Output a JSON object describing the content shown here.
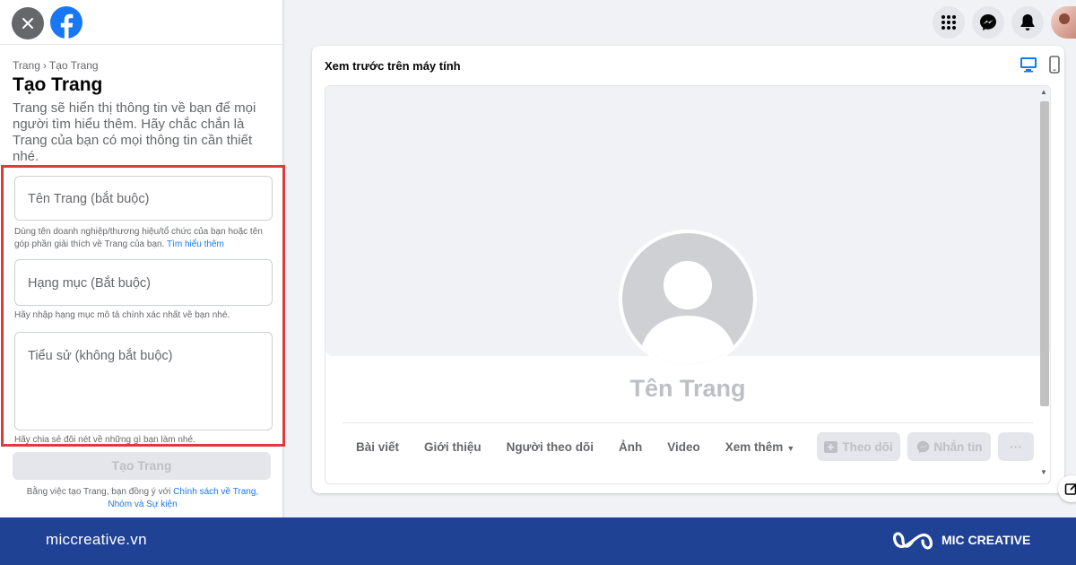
{
  "left_panel": {
    "breadcrumb": {
      "parent": "Trang",
      "separator": "›",
      "current": "Tạo Trang"
    },
    "title": "Tạo Trang",
    "description": "Trang sẽ hiển thị thông tin về bạn để mọi người tìm hiểu thêm. Hãy chắc chắn là Trang của bạn có mọi thông tin cần thiết nhé.",
    "form": {
      "page_name_placeholder": "Tên Trang (bắt buộc)",
      "page_name_hint": "Dùng tên doanh nghiệp/thương hiệu/tổ chức của bạn hoặc tên góp phần giải thích về Trang của bạn.",
      "page_name_hint_link": "Tìm hiểu thêm",
      "category_placeholder": "Hạng mục (Bắt buộc)",
      "category_hint": "Hãy nhập hạng mục mô tả chính xác nhất về bạn nhé.",
      "bio_placeholder": "Tiểu sử (không bắt buộc)",
      "bio_hint": "Hãy chia sẻ đôi nét về những gì bạn làm nhé."
    },
    "create_button": "Tạo Trang",
    "terms": {
      "text": "Bằng việc tạo Trang, bạn đồng ý với",
      "link": "Chính sách về Trang, Nhóm và Sự kiện"
    }
  },
  "top_icons": [
    "menu-grid-icon",
    "messenger-icon",
    "notification-bell-icon",
    "profile-avatar"
  ],
  "preview": {
    "title": "Xem trước trên máy tính",
    "page_name": "Tên Trang",
    "tabs": [
      {
        "label": "Bài viết"
      },
      {
        "label": "Giới thiệu"
      },
      {
        "label": "Người theo dõi"
      },
      {
        "label": "Ảnh"
      },
      {
        "label": "Video"
      },
      {
        "label": "Xem thêm"
      }
    ],
    "follow_button": "Theo dõi",
    "message_button": "Nhắn tin",
    "more_button": "···"
  },
  "footer": {
    "url": "miccreative.vn",
    "brand": "MIC CREATIVE"
  },
  "colors": {
    "facebook_blue": "#1877f2",
    "highlight_red": "#e03a3e",
    "footer_blue": "#1f4295"
  }
}
